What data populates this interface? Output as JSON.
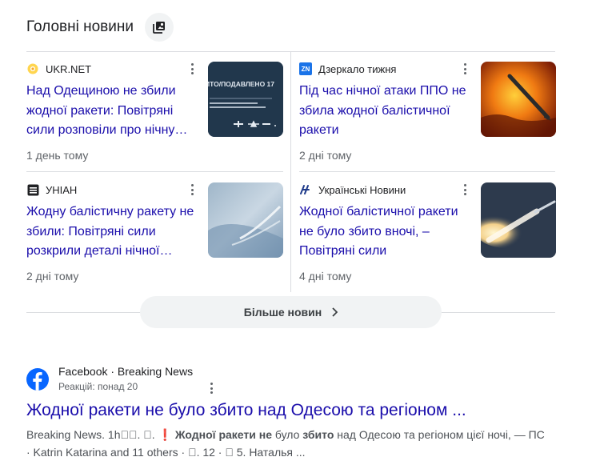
{
  "header": {
    "title": "Головні новини",
    "icon": "stacked-news-icon"
  },
  "cards": [
    {
      "source": "UKR.NET",
      "logo": "ukrnet-logo",
      "headline": "Над Одещиною не збили жодної ракети: Повітряні сили розповіли про нічну…",
      "time": "1 день тому",
      "thumb_text": "ИТО/ПОДАВЛЕНО 17"
    },
    {
      "source": "Дзеркало тижня",
      "logo": "zn-logo",
      "logo_text": "ZN",
      "headline": "Під час нічної атаки ППО не збила жодної балістичної ракети",
      "time": "2 дні тому"
    },
    {
      "source": "УНІАН",
      "logo": "unian-logo",
      "headline": "Жодну балістичну ракету не збили: Повітряні сили розкрили деталі нічної…",
      "time": "2 дні тому"
    },
    {
      "source": "Українські Новини",
      "logo": "ukrnovyny-logo",
      "headline": "Жодної балістичної ракети не було збито вночі, – Повітряні сили",
      "time": "4 дні тому"
    }
  ],
  "more_button": {
    "label": "Більше новин"
  },
  "result": {
    "source": "Facebook · Breaking News",
    "reactions": "Реакцій: понад 20",
    "title": "Жодної ракети не було збито над Одесою та регіоном ...",
    "snippet_pre": "Breaking News. 1h\u0000\u0000. \u0000. ",
    "snippet_excl": "❗",
    "snippet_b1": "Жодної ракети не",
    "snippet_m1": " було ",
    "snippet_b2": "збито",
    "snippet_m2": " над Одесою та регіоном цієї ночі, — ПС",
    "snippet_line2": "· Katrin Katarina and 11 others · \u0000. 12 · \u0000 5. Наталья ..."
  },
  "colors": {
    "link": "#1a0dab",
    "muted": "#5f6368",
    "facebook": "#0866ff"
  }
}
